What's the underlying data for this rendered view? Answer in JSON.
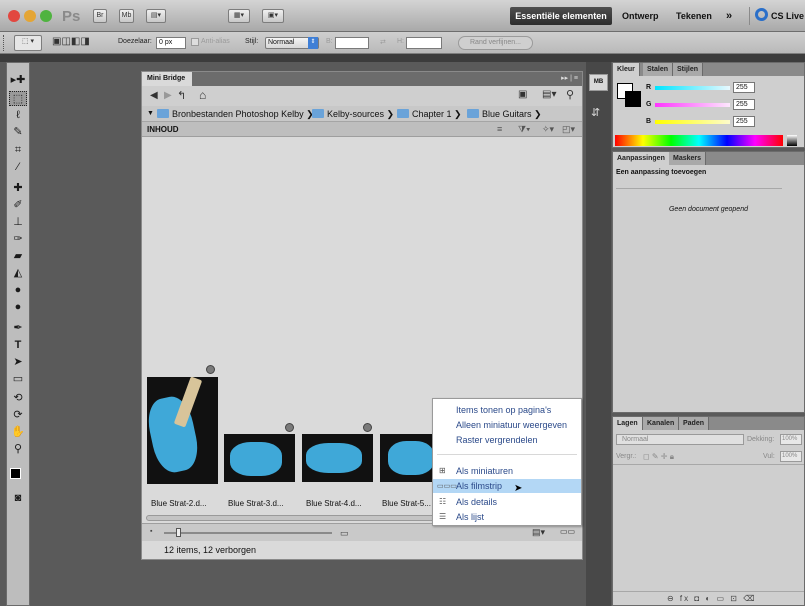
{
  "appbar": {
    "logo": "Ps",
    "br": "Br",
    "mb": "Mb",
    "workspaces": {
      "active": "Essentiële elementen",
      "design": "Ontwerp",
      "paint": "Tekenen",
      "more": "»"
    },
    "cs_live": "CS Live"
  },
  "options": {
    "feather_label": "Doezelaar:",
    "feather_value": "0 px",
    "antialias_label": "Anti-alias",
    "style_label": "Stijl:",
    "style_value": "Normaal",
    "width_label": "B:",
    "height_label": "H:",
    "refine_button": "Rand verfijnen..."
  },
  "minibridge": {
    "tab": "Mini Bridge",
    "breadcrumb": [
      "Bronbestanden Photoshop Kelby",
      "Kelby-sources",
      "Chapter 1",
      "Blue Guitars"
    ],
    "content_header": "INHOUD",
    "thumbnails": [
      {
        "caption": "Blue Strat-2.d..."
      },
      {
        "caption": "Blue Strat-3.d..."
      },
      {
        "caption": "Blue Strat-4.d..."
      },
      {
        "caption": "Blue Strat-5..."
      }
    ],
    "status": "12 items, 12 verborgen",
    "menu": {
      "items_top": [
        "Items tonen op pagina's",
        "Alleen miniatuur weergeven",
        "Raster vergrendelen"
      ],
      "items_views": [
        "Als miniaturen",
        "Als filmstrip",
        "Als details",
        "Als lijst"
      ],
      "selected": "Als filmstrip"
    }
  },
  "color_panel": {
    "tabs": [
      "Kleur",
      "Stalen",
      "Stijlen"
    ],
    "channels": [
      {
        "label": "R",
        "value": "255",
        "color": "#00e5ff"
      },
      {
        "label": "G",
        "value": "255",
        "color": "#ff35ff"
      },
      {
        "label": "B",
        "value": "255",
        "color": "#ffff00"
      }
    ]
  },
  "adjustments_panel": {
    "tabs": [
      "Aanpassingen",
      "Maskers"
    ],
    "title": "Een aanpassing toevoegen",
    "empty": "Geen document geopend"
  },
  "layers_panel": {
    "tabs": [
      "Lagen",
      "Kanalen",
      "Paden"
    ],
    "blend_mode": "Normaal",
    "opacity_label": "Dekking:",
    "opacity_value": "100%",
    "lock_label": "Vergr.:",
    "fill_label": "Vul:",
    "fill_value": "100%",
    "footer_icons": "⊖ fx ◘ ◐ ▭ ⊡ ⌫"
  }
}
